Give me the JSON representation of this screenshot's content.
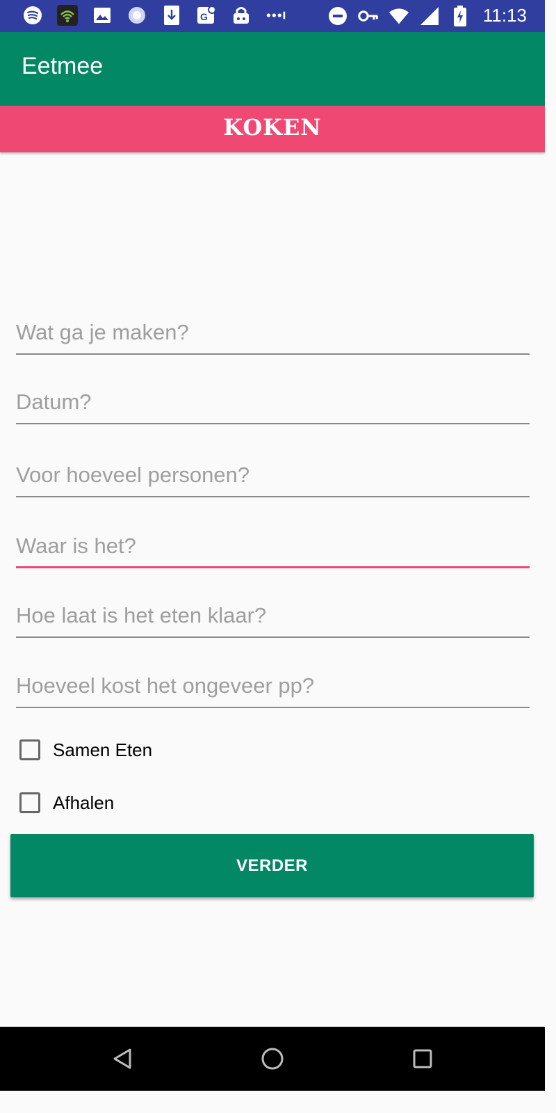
{
  "status_bar": {
    "time": "11:13",
    "icons_left": [
      "spotify-icon",
      "wifi-app-icon",
      "image-icon",
      "sync-icon",
      "download-icon",
      "maps-icon",
      "vpn-lock-icon",
      "more-dots-icon"
    ],
    "icons_right": [
      "do-not-disturb-icon",
      "key-icon",
      "wifi-icon",
      "signal-icon",
      "battery-charging-icon"
    ]
  },
  "app_bar": {
    "title": "Eetmee"
  },
  "banner": {
    "text": "KOKEN"
  },
  "form": {
    "fields": [
      {
        "placeholder": "Wat ga je maken?",
        "value": ""
      },
      {
        "placeholder": "Datum?",
        "value": ""
      },
      {
        "placeholder": "Voor hoeveel personen?",
        "value": ""
      },
      {
        "placeholder": "Waar is het?",
        "value": ""
      },
      {
        "placeholder": "Hoe laat is het eten klaar?",
        "value": ""
      },
      {
        "placeholder": "Hoeveel kost het ongeveer pp?",
        "value": ""
      }
    ],
    "checkboxes": [
      {
        "label": "Samen Eten",
        "checked": false
      },
      {
        "label": "Afhalen",
        "checked": false
      }
    ],
    "next_button": "VERDER"
  },
  "colors": {
    "primary": "#038866",
    "accent": "#ef4873",
    "status_bar": "#303f9f"
  },
  "nav_bar": {
    "icons": [
      "back-icon",
      "home-icon",
      "recents-icon"
    ]
  }
}
